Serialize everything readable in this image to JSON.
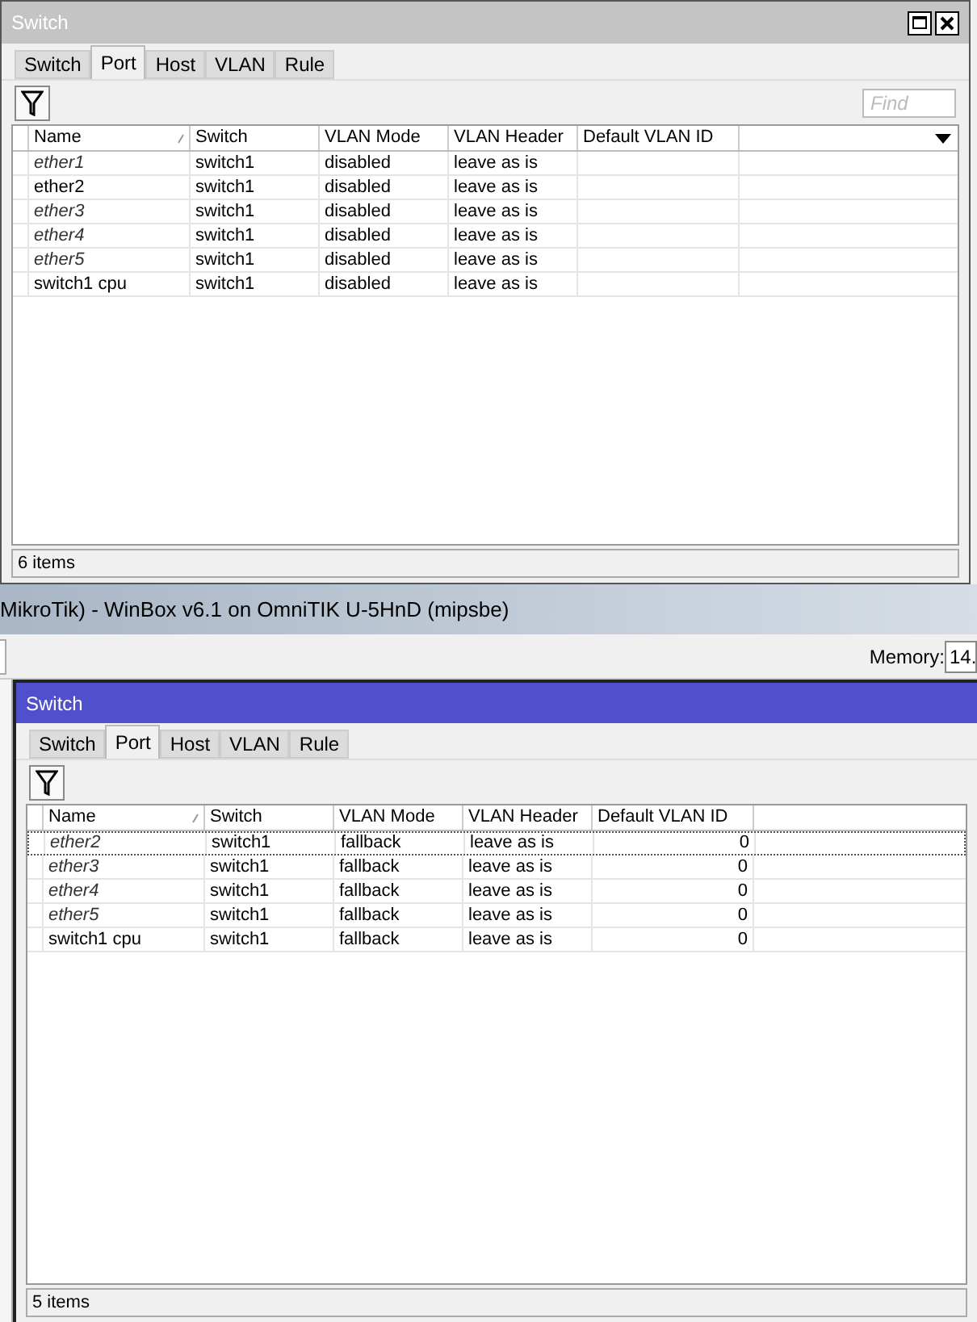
{
  "windows": [
    {
      "title": "Switch",
      "active": false,
      "tabs": [
        {
          "label": "Switch",
          "selected": false
        },
        {
          "label": "Port",
          "selected": true
        },
        {
          "label": "Host",
          "selected": false
        },
        {
          "label": "VLAN",
          "selected": false
        },
        {
          "label": "Rule",
          "selected": false
        }
      ],
      "find_placeholder": "Find",
      "columns": [
        "Name",
        "Switch",
        "VLAN Mode",
        "VLAN Header",
        "Default VLAN ID"
      ],
      "rows": [
        {
          "disabled": true,
          "selected": false,
          "cells": [
            "ether1",
            "switch1",
            "disabled",
            "leave as is",
            ""
          ]
        },
        {
          "disabled": false,
          "selected": false,
          "cells": [
            "ether2",
            "switch1",
            "disabled",
            "leave as is",
            ""
          ]
        },
        {
          "disabled": true,
          "selected": false,
          "cells": [
            "ether3",
            "switch1",
            "disabled",
            "leave as is",
            ""
          ]
        },
        {
          "disabled": true,
          "selected": false,
          "cells": [
            "ether4",
            "switch1",
            "disabled",
            "leave as is",
            ""
          ]
        },
        {
          "disabled": true,
          "selected": false,
          "cells": [
            "ether5",
            "switch1",
            "disabled",
            "leave as is",
            ""
          ]
        },
        {
          "disabled": false,
          "selected": false,
          "cells": [
            "switch1 cpu",
            "switch1",
            "disabled",
            "leave as is",
            ""
          ]
        }
      ],
      "status": "6 items"
    },
    {
      "title": "Switch",
      "active": true,
      "tabs": [
        {
          "label": "Switch",
          "selected": false
        },
        {
          "label": "Port",
          "selected": true
        },
        {
          "label": "Host",
          "selected": false
        },
        {
          "label": "VLAN",
          "selected": false
        },
        {
          "label": "Rule",
          "selected": false
        }
      ],
      "columns": [
        "Name",
        "Switch",
        "VLAN Mode",
        "VLAN Header",
        "Default VLAN ID"
      ],
      "rows": [
        {
          "disabled": true,
          "selected": true,
          "cells": [
            "ether2",
            "switch1",
            "fallback",
            "leave as is",
            "0"
          ]
        },
        {
          "disabled": true,
          "selected": false,
          "cells": [
            "ether3",
            "switch1",
            "fallback",
            "leave as is",
            "0"
          ]
        },
        {
          "disabled": true,
          "selected": false,
          "cells": [
            "ether4",
            "switch1",
            "fallback",
            "leave as is",
            "0"
          ]
        },
        {
          "disabled": true,
          "selected": false,
          "cells": [
            "ether5",
            "switch1",
            "fallback",
            "leave as is",
            "0"
          ]
        },
        {
          "disabled": false,
          "selected": false,
          "cells": [
            "switch1 cpu",
            "switch1",
            "fallback",
            "leave as is",
            "0"
          ]
        }
      ],
      "status": "5 items"
    }
  ],
  "app": {
    "title": "MikroTik) - WinBox v6.1 on OmniTIK U-5HnD (mipsbe)",
    "memory_label": "Memory:",
    "memory_value": "14."
  }
}
